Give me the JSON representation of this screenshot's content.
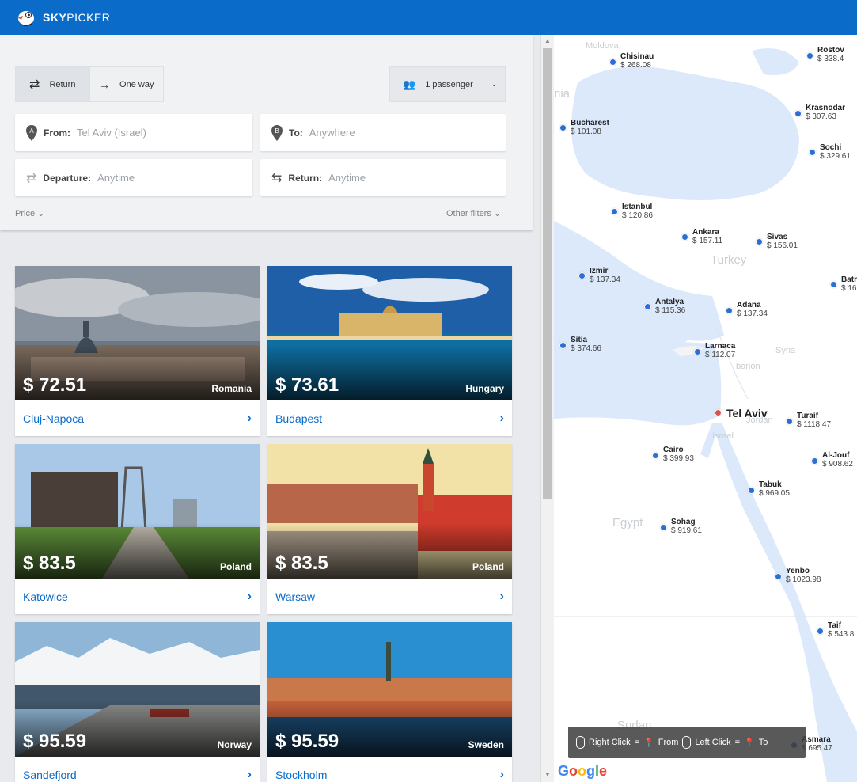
{
  "header": {
    "logo_bold": "SKY",
    "logo_light": "PICKER",
    "brand_color": "#0a6bc9"
  },
  "search": {
    "trip_types": [
      {
        "label": "Return",
        "active": true,
        "icon": "swap-icon"
      },
      {
        "label": "One way",
        "active": false,
        "icon": "arrow-right-icon"
      }
    ],
    "passengers": "1 passenger",
    "from_label": "From:",
    "from_value": "Tel Aviv (Israel)",
    "from_badge": "A",
    "to_label": "To:",
    "to_value": "Anywhere",
    "to_badge": "B",
    "departure_label": "Departure:",
    "departure_value": "Anytime",
    "return_label": "Return:",
    "return_value": "Anytime",
    "price_filter": "Price",
    "other_filters": "Other filters"
  },
  "destinations": [
    {
      "price": "$ 72.51",
      "country": "Romania",
      "city": "Cluj-Napoca"
    },
    {
      "price": "$ 73.61",
      "country": "Hungary",
      "city": "Budapest"
    },
    {
      "price": "$ 83.5",
      "country": "Poland",
      "city": "Katowice"
    },
    {
      "price": "$ 83.5",
      "country": "Poland",
      "city": "Warsaw"
    },
    {
      "price": "$ 95.59",
      "country": "Norway",
      "city": "Sandefjord"
    },
    {
      "price": "$ 95.59",
      "country": "Sweden",
      "city": "Stockholm"
    }
  ],
  "map": {
    "home": "Tel Aviv",
    "cities": [
      {
        "name": "Chisinau",
        "price": "$ 268.08"
      },
      {
        "name": "Rostov",
        "price": "$ 338.4"
      },
      {
        "name": "Bucharest",
        "price": "$ 101.08"
      },
      {
        "name": "Krasnodar",
        "price": "$ 307.63"
      },
      {
        "name": "Sochi",
        "price": "$ 329.61"
      },
      {
        "name": "Istanbul",
        "price": "$ 120.86"
      },
      {
        "name": "Ankara",
        "price": "$ 157.11"
      },
      {
        "name": "Sivas",
        "price": "$ 156.01"
      },
      {
        "name": "Izmir",
        "price": "$ 137.34"
      },
      {
        "name": "Batr",
        "price": "$ 16"
      },
      {
        "name": "Antalya",
        "price": "$ 115.36"
      },
      {
        "name": "Adana",
        "price": "$ 137.34"
      },
      {
        "name": "Sitia",
        "price": "$ 374.66"
      },
      {
        "name": "Larnaca",
        "price": "$ 112.07"
      },
      {
        "name": "Turaif",
        "price": "$ 1118.47"
      },
      {
        "name": "Cairo",
        "price": "$ 399.93"
      },
      {
        "name": "Al-Jouf",
        "price": "$ 908.62"
      },
      {
        "name": "Tabuk",
        "price": "$ 969.05"
      },
      {
        "name": "Sohag",
        "price": "$ 919.61"
      },
      {
        "name": "Yenbo",
        "price": "$ 1023.98"
      },
      {
        "name": "Taif",
        "price": "$ 543.8"
      },
      {
        "name": "Asmara",
        "price": "$ 695.47"
      }
    ],
    "regions": [
      "Moldova",
      "nia",
      "Turkey",
      "Syria",
      "Egypt",
      "banon",
      "Jordan",
      "Israel",
      "Sudan"
    ],
    "legend": {
      "right_click": "Right Click",
      "from": "From",
      "left_click": "Left Click",
      "to": "To",
      "eq": "="
    },
    "attribution": "Google"
  }
}
